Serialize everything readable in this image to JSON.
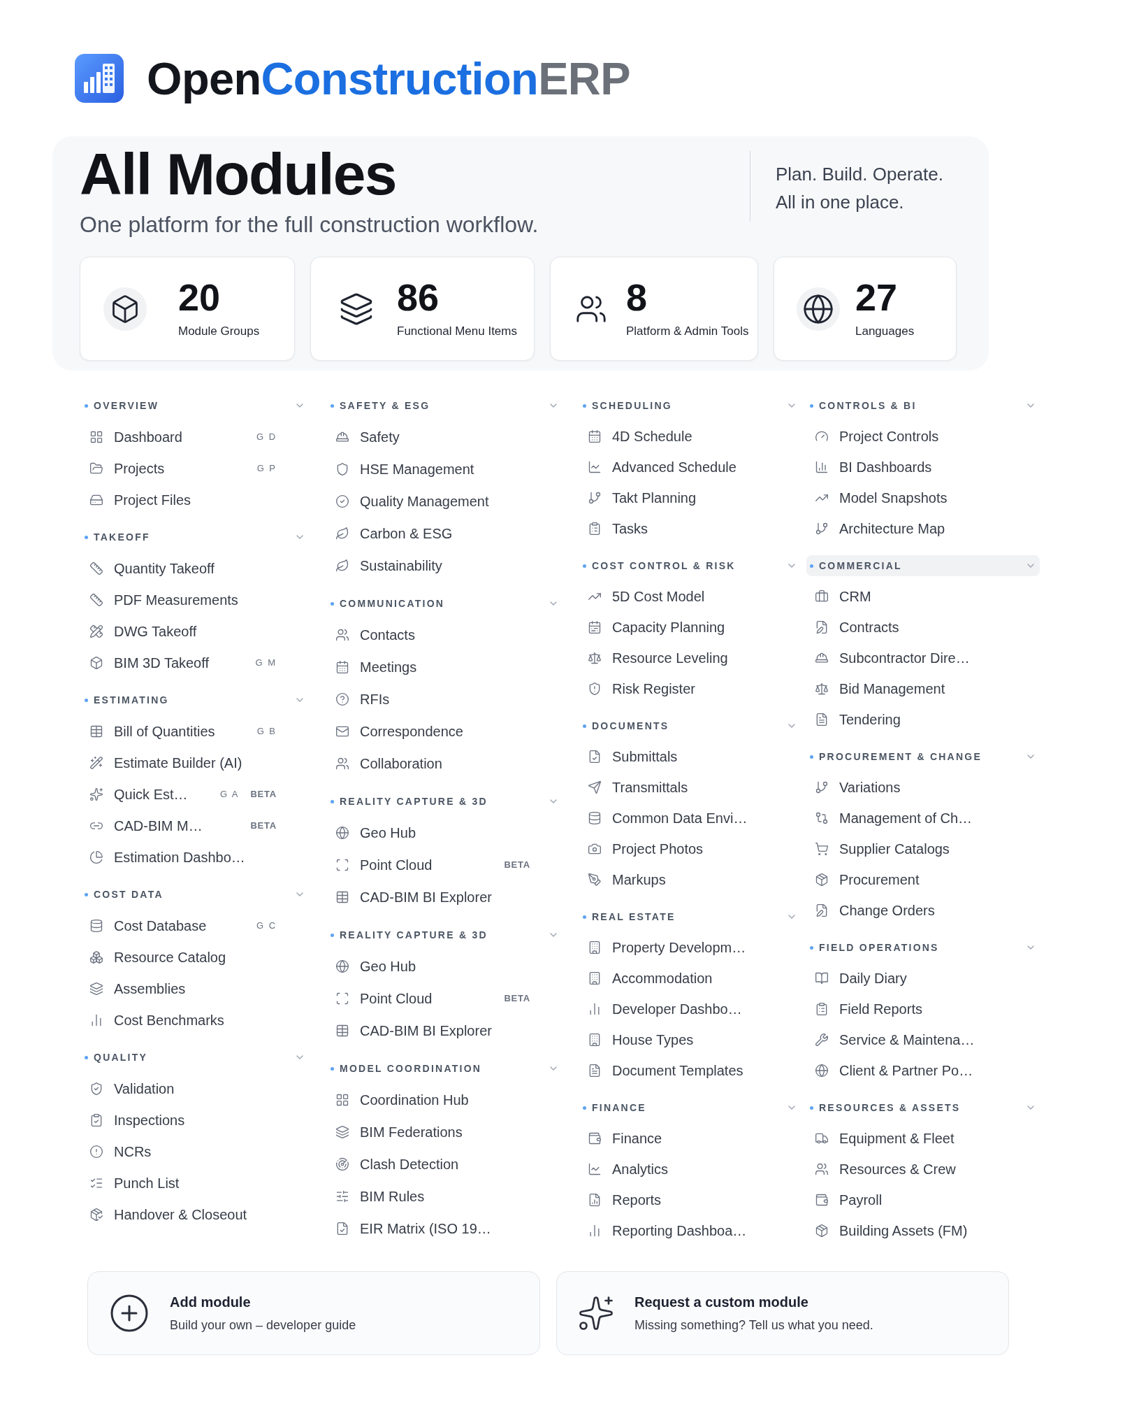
{
  "logo": {
    "wordmark": [
      {
        "text": "Open",
        "kind": "dark"
      },
      {
        "text": "Construction",
        "kind": "accent"
      },
      {
        "text": "ERP",
        "kind": "muted"
      }
    ]
  },
  "header": {
    "title": "All Modules",
    "subtitle": "One platform for the full construction workflow.",
    "tagline": [
      "Plan. Build. Operate.",
      "All in one place."
    ]
  },
  "stats": [
    {
      "value": "20",
      "label": "Module Groups"
    },
    {
      "value": "86",
      "label": "Functional Menu Items"
    },
    {
      "value": "8",
      "label": "Platform & Admin Tools"
    },
    {
      "value": "27",
      "label": "Languages"
    }
  ],
  "columns": [
    {
      "sections": [
        {
          "title": "OVERVIEW",
          "expanded": true,
          "highlighted": false,
          "items": [
            {
              "label": "Dashboard",
              "shortcut": "G D"
            },
            {
              "label": "Projects",
              "shortcut": "G P"
            },
            {
              "label": "Project Files"
            }
          ]
        },
        {
          "title": "TAKEOFF",
          "expanded": true,
          "highlighted": false,
          "items": [
            {
              "label": "Quantity Takeoff"
            },
            {
              "label": "PDF Measurements"
            },
            {
              "label": "DWG Takeoff"
            },
            {
              "label": "BIM 3D Takeoff",
              "shortcut": "G M"
            }
          ]
        },
        {
          "title": "ESTIMATING",
          "expanded": true,
          "highlighted": false,
          "items": [
            {
              "label": "Bill of Quantities",
              "shortcut": "G B"
            },
            {
              "label": "Estimate Builder (AI)"
            },
            {
              "label": "Quick Est…",
              "shortcut": "G A",
              "badge": "BETA"
            },
            {
              "label": "CAD-BIM M…",
              "badge": "BETA"
            },
            {
              "label": "Estimation Dashbo…"
            }
          ]
        },
        {
          "title": "COST DATA",
          "expanded": true,
          "highlighted": false,
          "items": [
            {
              "label": "Cost Database",
              "shortcut": "G C"
            },
            {
              "label": "Resource Catalog"
            },
            {
              "label": "Assemblies"
            },
            {
              "label": "Cost Benchmarks"
            }
          ]
        },
        {
          "title": "QUALITY",
          "expanded": true,
          "highlighted": false,
          "items": [
            {
              "label": "Validation"
            },
            {
              "label": "Inspections"
            },
            {
              "label": "NCRs"
            },
            {
              "label": "Punch List"
            },
            {
              "label": "Handover & Closeout"
            }
          ]
        }
      ]
    },
    {
      "sections": [
        {
          "title": "SAFETY & ESG",
          "expanded": true,
          "highlighted": false,
          "items": [
            {
              "label": "Safety"
            },
            {
              "label": "HSE Management"
            },
            {
              "label": "Quality Management"
            },
            {
              "label": "Carbon & ESG"
            },
            {
              "label": "Sustainability"
            }
          ]
        },
        {
          "title": "COMMUNICATION",
          "expanded": true,
          "highlighted": false,
          "items": [
            {
              "label": "Contacts"
            },
            {
              "label": "Meetings"
            },
            {
              "label": "RFIs"
            },
            {
              "label": "Correspondence"
            },
            {
              "label": "Collaboration"
            }
          ]
        },
        {
          "title": "REALITY CAPTURE & 3D",
          "expanded": true,
          "highlighted": false,
          "items": [
            {
              "label": "Geo Hub"
            },
            {
              "label": "Point Cloud",
              "badge": "BETA"
            },
            {
              "label": "CAD-BIM BI Explorer"
            }
          ]
        },
        {
          "title": "REALITY CAPTURE & 3D",
          "expanded": true,
          "highlighted": false,
          "items": [
            {
              "label": "Geo Hub"
            },
            {
              "label": "Point Cloud",
              "badge": "BETA"
            },
            {
              "label": "CAD-BIM BI Explorer"
            }
          ]
        },
        {
          "title": "MODEL COORDINATION",
          "expanded": true,
          "highlighted": false,
          "items": [
            {
              "label": "Coordination Hub"
            },
            {
              "label": "BIM Federations"
            },
            {
              "label": "Clash Detection"
            },
            {
              "label": "BIM Rules"
            },
            {
              "label": "EIR Matrix (ISO 19…"
            }
          ]
        }
      ]
    },
    {
      "sections": [
        {
          "title": "SCHEDULING",
          "expanded": true,
          "highlighted": false,
          "items": [
            {
              "label": "4D Schedule"
            },
            {
              "label": "Advanced Schedule"
            },
            {
              "label": "Takt Planning"
            },
            {
              "label": "Tasks"
            }
          ]
        },
        {
          "title": "COST CONTROL & RISK",
          "expanded": true,
          "highlighted": false,
          "items": [
            {
              "label": "5D Cost Model"
            },
            {
              "label": "Capacity Planning"
            },
            {
              "label": "Resource Leveling"
            },
            {
              "label": "Risk Register"
            }
          ]
        },
        {
          "title": "DOCUMENTS",
          "expanded": true,
          "highlighted": false,
          "items": [
            {
              "label": "Submittals"
            },
            {
              "label": "Transmittals"
            },
            {
              "label": "Common Data Envi…"
            },
            {
              "label": "Project Photos"
            },
            {
              "label": "Markups"
            }
          ]
        },
        {
          "title": "REAL ESTATE",
          "expanded": true,
          "highlighted": false,
          "items": [
            {
              "label": "Property Developm…"
            },
            {
              "label": "Accommodation"
            },
            {
              "label": "Developer Dashbo…"
            },
            {
              "label": "House Types"
            },
            {
              "label": "Document Templates"
            }
          ]
        },
        {
          "title": "FINANCE",
          "expanded": true,
          "highlighted": false,
          "items": [
            {
              "label": "Finance"
            },
            {
              "label": "Analytics"
            },
            {
              "label": "Reports"
            },
            {
              "label": "Reporting Dashboa…"
            }
          ]
        }
      ]
    },
    {
      "sections": [
        {
          "title": "CONTROLS & BI",
          "expanded": true,
          "highlighted": false,
          "items": [
            {
              "label": "Project Controls"
            },
            {
              "label": "BI Dashboards"
            },
            {
              "label": "Model Snapshots"
            },
            {
              "label": "Architecture Map"
            }
          ]
        },
        {
          "title": "COMMERCIAL",
          "expanded": true,
          "highlighted": true,
          "items": [
            {
              "label": "CRM"
            },
            {
              "label": "Contracts"
            },
            {
              "label": "Subcontractor Dire…"
            },
            {
              "label": "Bid Management"
            },
            {
              "label": "Tendering"
            }
          ]
        },
        {
          "title": "PROCUREMENT & CHANGE",
          "expanded": true,
          "highlighted": false,
          "items": [
            {
              "label": "Variations"
            },
            {
              "label": "Management of Ch…"
            },
            {
              "label": "Supplier Catalogs"
            },
            {
              "label": "Procurement"
            },
            {
              "label": "Change Orders"
            }
          ]
        },
        {
          "title": "FIELD OPERATIONS",
          "expanded": true,
          "highlighted": false,
          "items": [
            {
              "label": "Daily Diary"
            },
            {
              "label": "Field Reports"
            },
            {
              "label": "Service & Maintena…"
            },
            {
              "label": "Client & Partner Po…"
            }
          ]
        },
        {
          "title": "RESOURCES & ASSETS",
          "expanded": true,
          "highlighted": false,
          "items": [
            {
              "label": "Equipment & Fleet"
            },
            {
              "label": "Resources & Crew"
            },
            {
              "label": "Payroll"
            },
            {
              "label": "Building Assets (FM)"
            }
          ]
        }
      ]
    }
  ],
  "action_cards": [
    {
      "title": "Add module",
      "description": "Build your own – developer guide"
    },
    {
      "title": "Request a custom module",
      "description": "Missing something? Tell us what you need."
    }
  ]
}
